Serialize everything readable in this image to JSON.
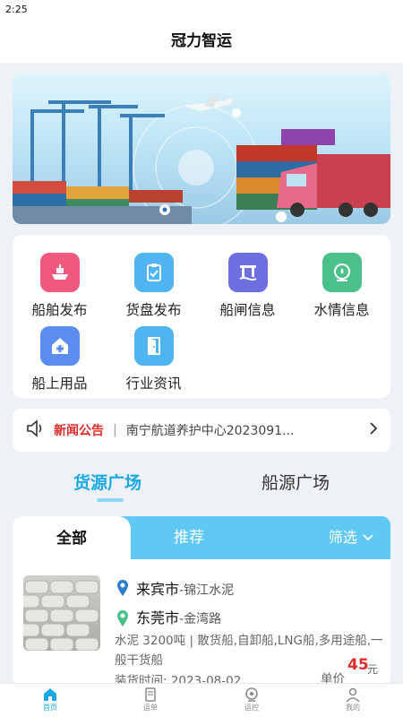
{
  "status_bar": {
    "time": "2:25"
  },
  "app": {
    "title": "冠力智运"
  },
  "menu": {
    "items": [
      {
        "label": "船舶发布",
        "icon": "ship-icon",
        "color": "#f0587d"
      },
      {
        "label": "货盘发布",
        "icon": "clipboard-check-icon",
        "color": "#4fb4f0"
      },
      {
        "label": "船闸信息",
        "icon": "lock-gate-icon",
        "color": "#6d6fe0"
      },
      {
        "label": "水情信息",
        "icon": "water-gauge-icon",
        "color": "#4cc08a"
      },
      {
        "label": "船上用品",
        "icon": "home-plus-icon",
        "color": "#5b8cf0"
      },
      {
        "label": "行业资讯",
        "icon": "door-news-icon",
        "color": "#4fb4f0"
      }
    ]
  },
  "notice": {
    "tag": "新闻公告",
    "separator": "|",
    "text": "南宁航道养护中心2023091...",
    "icon": "speaker-icon"
  },
  "tabs": {
    "active": "货源广场",
    "inactive": "船源广场"
  },
  "filter": {
    "all": "全部",
    "recommend": "推荐",
    "screen": "筛选"
  },
  "listing": {
    "origin_city": "来宾市",
    "origin_detail": "-锦江水泥",
    "dest_city": "东莞市",
    "dest_detail": "-金湾路",
    "spec": "水泥 3200吨 | 散货船,自卸船,LNG船,多用途船,一般干货船",
    "date": "装货时间: 2023-08-02",
    "price_label": "单价",
    "price_value": "45",
    "price_unit": "元"
  },
  "bottom_nav": [
    {
      "label": "首页",
      "icon": "home-icon",
      "active": true
    },
    {
      "label": "运单",
      "icon": "waybill-icon",
      "active": false
    },
    {
      "label": "运控",
      "icon": "monitor-icon",
      "active": false
    },
    {
      "label": "我的",
      "icon": "user-icon",
      "active": false
    }
  ],
  "colors": {
    "accent": "#1aa8e6",
    "filter_bar": "#5fc8f3",
    "price": "#e02b2b",
    "notice_tag": "#e02b2b"
  }
}
